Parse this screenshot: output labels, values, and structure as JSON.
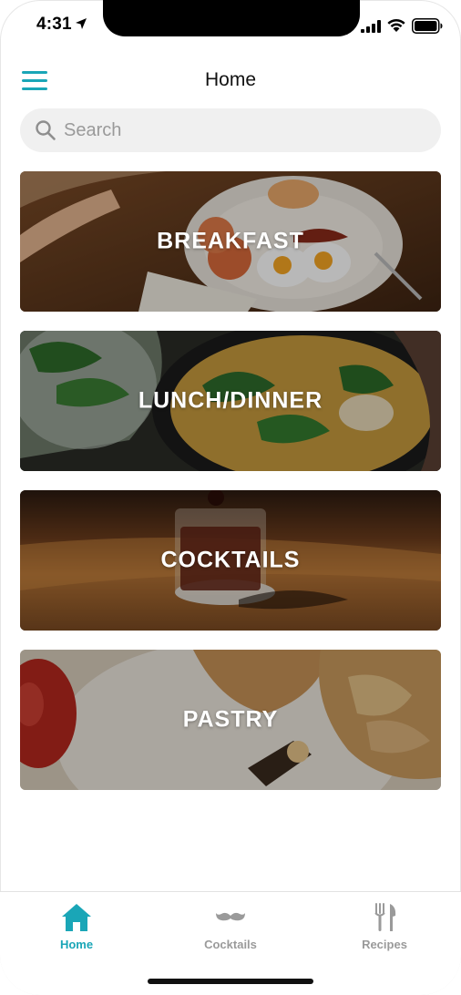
{
  "status_bar": {
    "time": "4:31"
  },
  "header": {
    "title": "Home"
  },
  "search": {
    "placeholder": "Search"
  },
  "categories": [
    {
      "label": "BREAKFAST"
    },
    {
      "label": "LUNCH/DINNER"
    },
    {
      "label": "COCKTAILS"
    },
    {
      "label": "PASTRY"
    }
  ],
  "tabs": [
    {
      "label": "Home",
      "icon": "home-icon",
      "active": true
    },
    {
      "label": "Cocktails",
      "icon": "mustache-icon",
      "active": false
    },
    {
      "label": "Recipes",
      "icon": "fork-knife-icon",
      "active": false
    }
  ],
  "colors": {
    "accent": "#1aa6b7",
    "inactive": "#9a9a9a",
    "search_bg": "#f0f0f0"
  }
}
